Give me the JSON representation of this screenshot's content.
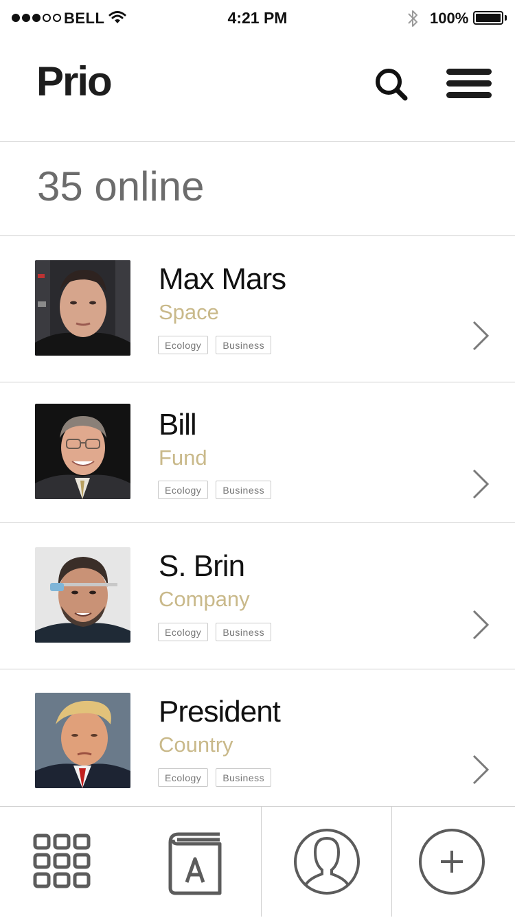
{
  "status_bar": {
    "carrier": "BELL",
    "time": "4:21 PM",
    "battery": "100%",
    "signal_bars_filled": 3,
    "signal_bars_total": 5
  },
  "header": {
    "title": "Prio",
    "search_icon": "search-icon",
    "menu_icon": "hamburger-menu-icon"
  },
  "online": {
    "label": "35 online"
  },
  "people": [
    {
      "name": "Max Mars",
      "role": "Space",
      "tags": [
        "Ecology",
        "Business"
      ]
    },
    {
      "name": "Bill",
      "role": "Fund",
      "tags": [
        "Ecology",
        "Business"
      ]
    },
    {
      "name": "S. Brin",
      "role": "Company",
      "tags": [
        "Ecology",
        "Business"
      ]
    },
    {
      "name": "President",
      "role": "Country",
      "tags": [
        "Ecology",
        "Business"
      ]
    }
  ],
  "tab_bar": {
    "items": [
      "grid-icon",
      "address-book-icon",
      "profile-icon",
      "add-icon"
    ]
  },
  "colors": {
    "accent_gold": "#c9b98a",
    "icon_gray": "#5c5c5c",
    "divider": "#cfcfcf"
  }
}
